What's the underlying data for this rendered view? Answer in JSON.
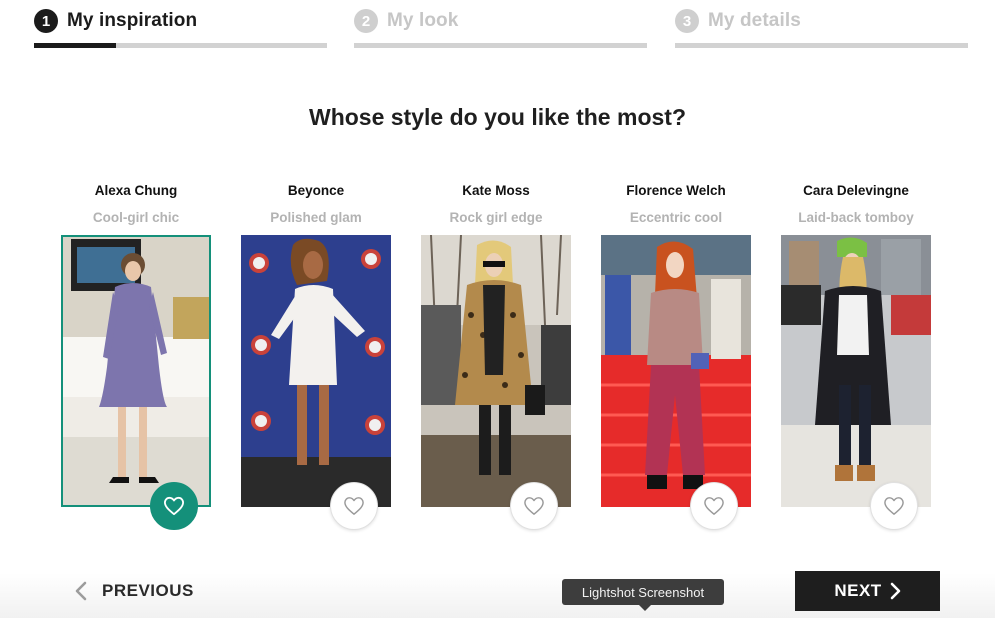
{
  "steps": [
    {
      "number": "1",
      "label": "My inspiration",
      "active": true,
      "progress": 0.28
    },
    {
      "number": "2",
      "label": "My look",
      "active": false,
      "progress": 0
    },
    {
      "number": "3",
      "label": "My details",
      "active": false,
      "progress": 0
    }
  ],
  "question": "Whose style do you like the most?",
  "cards": [
    {
      "name": "Alexa Chung",
      "style": "Cool-girl chic",
      "selected": true
    },
    {
      "name": "Beyonce",
      "style": "Polished glam",
      "selected": false
    },
    {
      "name": "Kate Moss",
      "style": "Rock girl edge",
      "selected": false
    },
    {
      "name": "Florence Welch",
      "style": "Eccentric cool",
      "selected": false
    },
    {
      "name": "Cara Delevingne",
      "style": "Laid-back tomboy",
      "selected": false
    }
  ],
  "nav": {
    "previous_label": "PREVIOUS",
    "next_label": "NEXT"
  },
  "tooltip": "Lightshot Screenshot",
  "icons": {
    "like": "heart-icon",
    "previous": "chevron-left-icon",
    "next": "chevron-right-icon"
  },
  "colors": {
    "accent": "#14907a",
    "active_step": "#1b1b1b",
    "inactive_step": "#c6c6c6",
    "next_button": "#1e1e1e"
  }
}
